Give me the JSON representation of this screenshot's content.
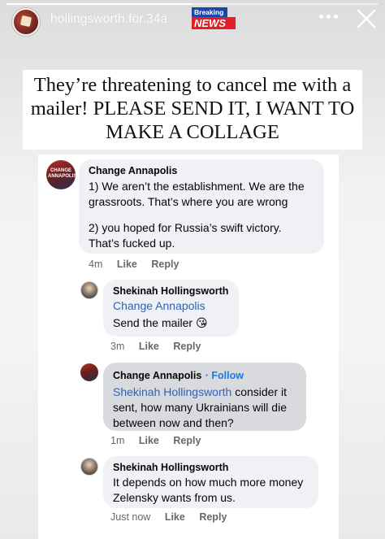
{
  "story": {
    "progress": 0.5,
    "username": "hollingsworth.for.34a",
    "badge": {
      "top": "Breaking",
      "bottom": "NEWS"
    },
    "more_icon": "more-horizontal-icon",
    "close_icon": "close-icon",
    "caption": "They’re threatening to cancel me with a mailer! PLEASE SEND IT, I WANT TO MAKE A COLLAGE"
  },
  "comments": [
    {
      "author": "Change Annapolis",
      "avatar_text": "CHANGE ANNAPOLIS",
      "text_1": "1) We aren’t the establishment. We are the grassroots. That’s where you are wrong",
      "text_2": "2) you hoped for Russia’s swift victory. That’s fucked up.",
      "time": "4m",
      "like": "Like",
      "reply": "Reply"
    },
    {
      "author": "Shekinah Hollingsworth",
      "mention": "Change Annapolis",
      "text": "Send the mailer 😘",
      "time": "3m",
      "like": "Like",
      "reply": "Reply"
    },
    {
      "author": "Change Annapolis",
      "follow": "· Follow",
      "mention": "Shekinah Hollingsworth",
      "text": " consider it sent, how many Ukrainians will die between now and then?",
      "time": "1m",
      "like": "Like",
      "reply": "Reply"
    },
    {
      "author": "Shekinah Hollingsworth",
      "text": "It depends on how much more money Zelensky wants from us.",
      "time": "Just now",
      "like": "Like",
      "reply": "Reply"
    }
  ],
  "colors": {
    "bubble": "#eff1f4",
    "bubble_highlight": "#d8dade",
    "link": "#2f63b5",
    "follow": "#1877f2",
    "meta": "#65676b",
    "badge_blue": "#1b47a8",
    "badge_red": "#e21f26"
  }
}
